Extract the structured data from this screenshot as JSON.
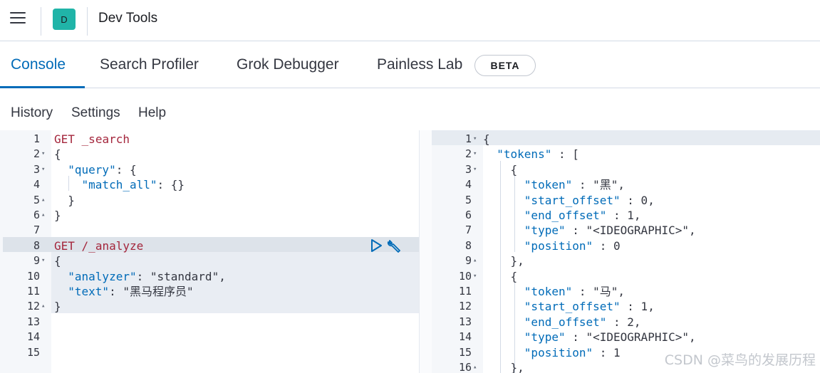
{
  "header": {
    "avatar_letter": "D",
    "title": "Dev Tools"
  },
  "tabs": [
    {
      "label": "Console",
      "active": true
    },
    {
      "label": "Search Profiler",
      "active": false
    },
    {
      "label": "Grok Debugger",
      "active": false
    },
    {
      "label": "Painless Lab",
      "active": false
    }
  ],
  "beta_badge": "BETA",
  "menu": {
    "history": "History",
    "settings": "Settings",
    "help": "Help"
  },
  "request_lines": [
    {
      "n": "1",
      "fold": "",
      "code": "GET _search"
    },
    {
      "n": "2",
      "fold": "▾",
      "code": "{"
    },
    {
      "n": "3",
      "fold": "▾",
      "code": "  \"query\": {"
    },
    {
      "n": "4",
      "fold": "",
      "code": "    \"match_all\": {}"
    },
    {
      "n": "5",
      "fold": "▴",
      "code": "  }"
    },
    {
      "n": "6",
      "fold": "▴",
      "code": "}"
    },
    {
      "n": "7",
      "fold": "",
      "code": ""
    },
    {
      "n": "8",
      "fold": "",
      "code": "GET /_analyze"
    },
    {
      "n": "9",
      "fold": "▾",
      "code": "{"
    },
    {
      "n": "10",
      "fold": "",
      "code": "  \"analyzer\": \"standard\","
    },
    {
      "n": "11",
      "fold": "",
      "code": "  \"text\": \"黑马程序员\""
    },
    {
      "n": "12",
      "fold": "▴",
      "code": "}"
    },
    {
      "n": "13",
      "fold": "",
      "code": ""
    },
    {
      "n": "14",
      "fold": "",
      "code": ""
    },
    {
      "n": "15",
      "fold": "",
      "code": ""
    }
  ],
  "response_lines": [
    {
      "n": "1",
      "fold": "▾",
      "code": "{"
    },
    {
      "n": "2",
      "fold": "▾",
      "code": "  \"tokens\" : ["
    },
    {
      "n": "3",
      "fold": "▾",
      "code": "    {"
    },
    {
      "n": "4",
      "fold": "",
      "code": "      \"token\" : \"黑\","
    },
    {
      "n": "5",
      "fold": "",
      "code": "      \"start_offset\" : 0,"
    },
    {
      "n": "6",
      "fold": "",
      "code": "      \"end_offset\" : 1,"
    },
    {
      "n": "7",
      "fold": "",
      "code": "      \"type\" : \"<IDEOGRAPHIC>\","
    },
    {
      "n": "8",
      "fold": "",
      "code": "      \"position\" : 0"
    },
    {
      "n": "9",
      "fold": "▴",
      "code": "    },"
    },
    {
      "n": "10",
      "fold": "▾",
      "code": "    {"
    },
    {
      "n": "11",
      "fold": "",
      "code": "      \"token\" : \"马\","
    },
    {
      "n": "12",
      "fold": "",
      "code": "      \"start_offset\" : 1,"
    },
    {
      "n": "13",
      "fold": "",
      "code": "      \"end_offset\" : 2,"
    },
    {
      "n": "14",
      "fold": "",
      "code": "      \"type\" : \"<IDEOGRAPHIC>\","
    },
    {
      "n": "15",
      "fold": "",
      "code": "      \"position\" : 1"
    },
    {
      "n": "16",
      "fold": "▴",
      "code": "    },"
    }
  ],
  "watermark": "CSDN @菜鸟的发展历程",
  "colors": {
    "accent": "#006bb8",
    "avatar": "#20b4a8",
    "keyword": "#a4263c",
    "string": "#287a2a"
  },
  "icons": {
    "menu": "hamburger-icon",
    "run": "play-icon",
    "settings": "wrench-icon"
  }
}
